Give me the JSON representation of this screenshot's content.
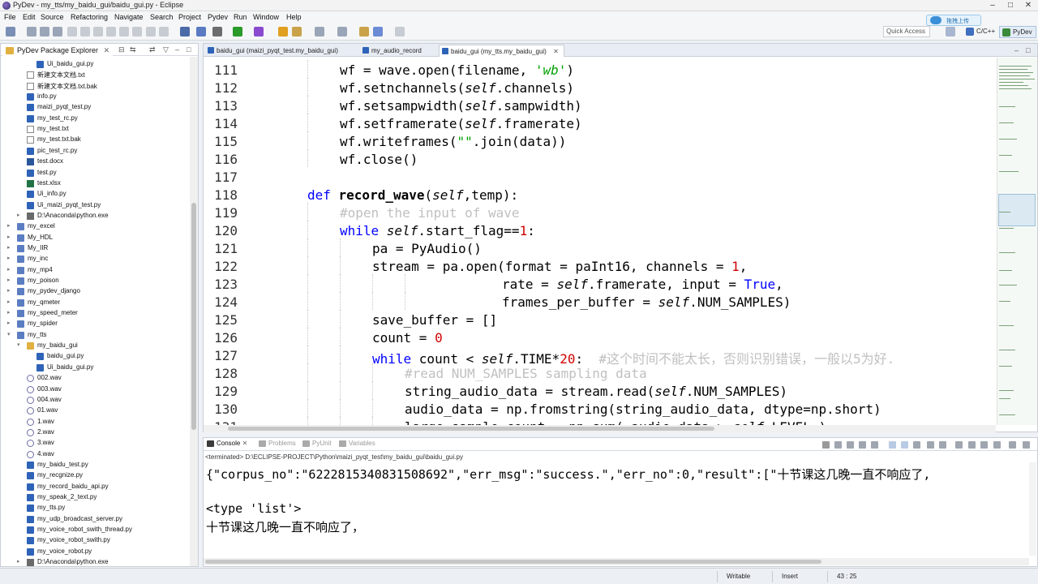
{
  "window": {
    "title": "PyDev - my_tts/my_baidu_gui/baidu_gui.py - Eclipse"
  },
  "menu": [
    "File",
    "Edit",
    "Source",
    "Refactoring",
    "Navigate",
    "Search",
    "Project",
    "Pydev",
    "Run",
    "Window",
    "Help"
  ],
  "toolbar": {
    "quick_access": "Quick Access",
    "perspectives": [
      "C/C++",
      "PyDev"
    ],
    "cloud_upload": "拖拽上传"
  },
  "explorer": {
    "tab_label": "PyDev Package Explorer",
    "items": [
      {
        "label": "Ui_baidu_gui.py",
        "icon": "python-file-icon",
        "arrow": ""
      },
      {
        "label": "新建文本文档.txt",
        "icon": "text-file-icon",
        "arrow": ""
      },
      {
        "label": "新建文本文档.txt.bak",
        "icon": "text-file-icon",
        "arrow": ""
      },
      {
        "label": "info.py",
        "icon": "python-file-icon",
        "arrow": ""
      },
      {
        "label": "maizi_pyqt_test.py",
        "icon": "python-file-icon",
        "arrow": ""
      },
      {
        "label": "my_test_rc.py",
        "icon": "python-file-icon",
        "arrow": ""
      },
      {
        "label": "my_test.txt",
        "icon": "text-file-icon",
        "arrow": ""
      },
      {
        "label": "my_test.txt.bak",
        "icon": "text-file-icon",
        "arrow": ""
      },
      {
        "label": "pic_test_rc.py",
        "icon": "python-file-icon",
        "arrow": ""
      },
      {
        "label": "test.docx",
        "icon": "word-file-icon",
        "arrow": ""
      },
      {
        "label": "test.py",
        "icon": "python-file-icon",
        "arrow": ""
      },
      {
        "label": "test.xlsx",
        "icon": "excel-file-icon",
        "arrow": ""
      },
      {
        "label": "Ui_info.py",
        "icon": "python-file-icon",
        "arrow": ""
      },
      {
        "label": "Ui_maizi_pyqt_test.py",
        "icon": "python-file-icon",
        "arrow": ""
      },
      {
        "label": "D:\\Anaconda\\python.exe",
        "icon": "interpreter-icon",
        "arrow": "▸"
      },
      {
        "label": "my_excel",
        "icon": "project-icon",
        "arrow": "▸"
      },
      {
        "label": "My_HDL",
        "icon": "project-icon",
        "arrow": "▸"
      },
      {
        "label": "My_IIR",
        "icon": "project-icon",
        "arrow": "▸"
      },
      {
        "label": "my_inc",
        "icon": "project-icon",
        "arrow": "▸"
      },
      {
        "label": "my_mp4",
        "icon": "project-icon",
        "arrow": "▸"
      },
      {
        "label": "my_poison",
        "icon": "project-icon",
        "arrow": "▸"
      },
      {
        "label": "my_pydev_django",
        "icon": "project-icon",
        "arrow": "▸"
      },
      {
        "label": "my_qmeter",
        "icon": "project-icon",
        "arrow": "▸"
      },
      {
        "label": "my_speed_meter",
        "icon": "project-icon",
        "arrow": "▸"
      },
      {
        "label": "my_spider",
        "icon": "project-icon",
        "arrow": "▸"
      },
      {
        "label": "my_tts",
        "icon": "project-icon",
        "arrow": "▾"
      },
      {
        "label": "my_baidu_gui",
        "icon": "package-icon",
        "arrow": "▾"
      },
      {
        "label": "baidu_gui.py",
        "icon": "python-file-icon",
        "arrow": ""
      },
      {
        "label": "Ui_baidu_gui.py",
        "icon": "python-file-icon",
        "arrow": ""
      },
      {
        "label": "002.wav",
        "icon": "audio-file-icon",
        "arrow": ""
      },
      {
        "label": "003.wav",
        "icon": "audio-file-icon",
        "arrow": ""
      },
      {
        "label": "004.wav",
        "icon": "audio-file-icon",
        "arrow": ""
      },
      {
        "label": "01.wav",
        "icon": "audio-file-icon",
        "arrow": ""
      },
      {
        "label": "1.wav",
        "icon": "audio-file-icon",
        "arrow": ""
      },
      {
        "label": "2.wav",
        "icon": "audio-file-icon",
        "arrow": ""
      },
      {
        "label": "3.wav",
        "icon": "audio-file-icon",
        "arrow": ""
      },
      {
        "label": "4.wav",
        "icon": "audio-file-icon",
        "arrow": ""
      },
      {
        "label": "my_baidu_test.py",
        "icon": "python-file-icon",
        "arrow": ""
      },
      {
        "label": "my_recgnize.py",
        "icon": "python-file-icon",
        "arrow": ""
      },
      {
        "label": "my_record_baidu_api.py",
        "icon": "python-file-icon",
        "arrow": ""
      },
      {
        "label": "my_speak_2_text.py",
        "icon": "python-file-icon",
        "arrow": ""
      },
      {
        "label": "my_tts.py",
        "icon": "python-file-icon",
        "arrow": ""
      },
      {
        "label": "my_udp_broadcast_server.py",
        "icon": "python-file-icon",
        "arrow": ""
      },
      {
        "label": "my_voice_robot_swith_thread.py",
        "icon": "python-file-icon",
        "arrow": ""
      },
      {
        "label": "my_voice_robot_swith.py",
        "icon": "python-file-icon",
        "arrow": ""
      },
      {
        "label": "my_voice_robot.py",
        "icon": "python-file-icon",
        "arrow": ""
      },
      {
        "label": "D:\\Anaconda\\python.exe",
        "icon": "interpreter-icon",
        "arrow": "▸"
      }
    ]
  },
  "editor": {
    "tabs": [
      {
        "label": "baidu_gui (maizi_pyqt_test.my_baidu_gui)",
        "active": false
      },
      {
        "label": "my_audio_record",
        "active": false
      },
      {
        "label": "baidu_gui (my_tts.my_baidu_gui)",
        "active": true
      }
    ],
    "lines": [
      {
        "n": "111",
        "indent": 2,
        "tokens": [
          [
            "",
            "wf = wave.open(filename, "
          ],
          [
            "str",
            "'wb'"
          ],
          [
            "",
            ")"
          ]
        ]
      },
      {
        "n": "112",
        "indent": 2,
        "tokens": [
          [
            "",
            "wf.setnchannels("
          ],
          [
            "self",
            "self"
          ],
          [
            "",
            ".channels)"
          ]
        ]
      },
      {
        "n": "113",
        "indent": 2,
        "tokens": [
          [
            "",
            "wf.setsampwidth("
          ],
          [
            "self",
            "self"
          ],
          [
            "",
            ".sampwidth)"
          ]
        ]
      },
      {
        "n": "114",
        "indent": 2,
        "tokens": [
          [
            "",
            "wf.setframerate("
          ],
          [
            "self",
            "self"
          ],
          [
            "",
            ".framerate)"
          ]
        ]
      },
      {
        "n": "115",
        "indent": 2,
        "tokens": [
          [
            "",
            "wf.writeframes("
          ],
          [
            "str",
            "\"\""
          ],
          [
            "",
            ".join(data))"
          ]
        ]
      },
      {
        "n": "116",
        "indent": 2,
        "tokens": [
          [
            "",
            "wf.close()"
          ]
        ]
      },
      {
        "n": "117",
        "indent": 0,
        "tokens": []
      },
      {
        "n": "118",
        "indent": 1,
        "tokens": [
          [
            "kw",
            "def "
          ],
          [
            "fn",
            "record_wave"
          ],
          [
            "",
            "("
          ],
          [
            "self",
            "self"
          ],
          [
            "",
            ",temp):"
          ]
        ]
      },
      {
        "n": "119",
        "indent": 2,
        "tokens": [
          [
            "cmt",
            "#open the input of wave"
          ]
        ]
      },
      {
        "n": "120",
        "indent": 2,
        "tokens": [
          [
            "kw",
            "while "
          ],
          [
            "self",
            "self"
          ],
          [
            "",
            ".start_flag=="
          ],
          [
            "num",
            "1"
          ],
          [
            "",
            ":"
          ]
        ]
      },
      {
        "n": "121",
        "indent": 3,
        "tokens": [
          [
            "",
            "pa = PyAudio()"
          ]
        ]
      },
      {
        "n": "122",
        "indent": 3,
        "tokens": [
          [
            "",
            "stream = pa.open(format = paInt16, channels = "
          ],
          [
            "num",
            "1"
          ],
          [
            "",
            ","
          ]
        ]
      },
      {
        "n": "123",
        "indent": 7,
        "tokens": [
          [
            "",
            "rate = "
          ],
          [
            "self",
            "self"
          ],
          [
            "",
            ".framerate, input = "
          ],
          [
            "kw",
            "True"
          ],
          [
            "",
            ","
          ]
        ]
      },
      {
        "n": "124",
        "indent": 7,
        "tokens": [
          [
            "",
            "frames_per_buffer = "
          ],
          [
            "self",
            "self"
          ],
          [
            "",
            ".NUM_SAMPLES)"
          ]
        ]
      },
      {
        "n": "125",
        "indent": 3,
        "tokens": [
          [
            "",
            "save_buffer = []"
          ]
        ]
      },
      {
        "n": "126",
        "indent": 3,
        "tokens": [
          [
            "",
            "count = "
          ],
          [
            "num",
            "0"
          ]
        ]
      },
      {
        "n": "127",
        "indent": 3,
        "tokens": [
          [
            "kw",
            "while "
          ],
          [
            "",
            "count < "
          ],
          [
            "self",
            "self"
          ],
          [
            "",
            ".TIME*"
          ],
          [
            "num",
            "20"
          ],
          [
            "",
            ":  "
          ],
          [
            "cmt",
            "#这个时间不能太长，否则识别错误，一般以5为好."
          ]
        ]
      },
      {
        "n": "128",
        "indent": 4,
        "tokens": [
          [
            "cmt",
            "#read NUM_SAMPLES sampling data"
          ]
        ]
      },
      {
        "n": "129",
        "indent": 4,
        "tokens": [
          [
            "",
            "string_audio_data = stream.read("
          ],
          [
            "self",
            "self"
          ],
          [
            "",
            ".NUM_SAMPLES)"
          ]
        ]
      },
      {
        "n": "130",
        "indent": 4,
        "tokens": [
          [
            "",
            "audio_data = np.fromstring(string_audio_data, dtype=np.short)"
          ]
        ]
      },
      {
        "n": "131",
        "indent": 4,
        "tokens": [
          [
            "",
            "large_sample_count = np.sum( audio_data > "
          ],
          [
            "self",
            "self"
          ],
          [
            "",
            ".LEVEL )"
          ]
        ]
      }
    ]
  },
  "console": {
    "tabs": [
      "Console",
      "Problems",
      "PyUnit",
      "Variables"
    ],
    "path": "<terminated> D:\\ECLIPSE-PROJECT\\Python\\maizi_pyqt_test\\my_baidu_gui\\baidu_gui.py",
    "lines": [
      "{\"corpus_no\":\"6222815340831508692\",\"err_msg\":\"success.\",\"err_no\":0,\"result\":[\"十节课这几晚一直不响应了,",
      "",
      "<type 'list'>",
      "十节课这几晚一直不响应了，"
    ]
  },
  "status": {
    "mode": "Writable",
    "insert": "Insert",
    "position": "43 : 25"
  },
  "colors": {
    "keyword": "#0000ff",
    "number": "#d00000",
    "string": "#00a000",
    "comment": "#c0c0c0"
  }
}
